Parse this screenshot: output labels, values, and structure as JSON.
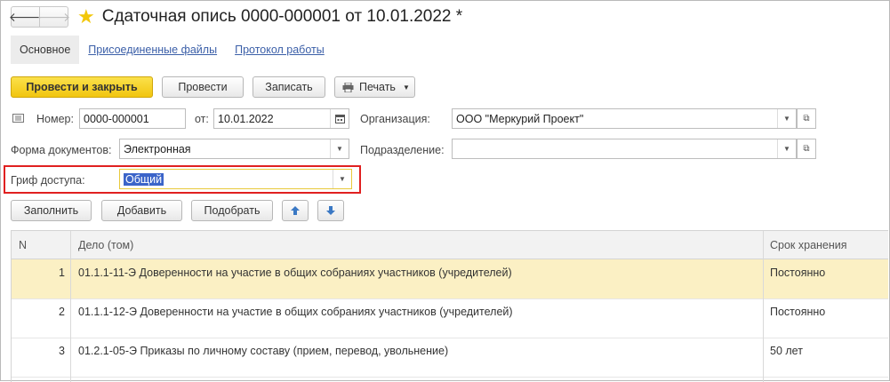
{
  "title_bar": {
    "back_icon": "arrow-left-icon",
    "forward_icon": "arrow-right-icon",
    "favorite_icon": "star-icon",
    "title": "Сдаточная опись 0000-000001 от 10.01.2022 *"
  },
  "tabs": [
    {
      "label": "Основное",
      "active": true
    },
    {
      "label": "Присоединенные файлы",
      "active": false
    },
    {
      "label": "Протокол работы",
      "active": false
    }
  ],
  "toolbar": {
    "post_close_label": "Провести и закрыть",
    "post_label": "Провести",
    "save_label": "Записать",
    "print_label": "Печать"
  },
  "form": {
    "number_label": "Номер:",
    "number_value": "0000-000001",
    "date_label": "от:",
    "date_value": "10.01.2022",
    "org_label": "Организация:",
    "org_value": "ООО \"Меркурий Проект\"",
    "doc_form_label": "Форма документов:",
    "doc_form_value": "Электронная",
    "subdivision_label": "Подразделение:",
    "subdivision_value": "",
    "access_label": "Гриф доступа:",
    "access_value": "Общий"
  },
  "table_toolbar": {
    "fill_label": "Заполнить",
    "add_label": "Добавить",
    "pick_label": "Подобрать",
    "up_icon": "arrow-up-icon",
    "down_icon": "arrow-down-icon"
  },
  "table": {
    "columns": [
      "N",
      "Дело (том)",
      "Срок хранения"
    ],
    "rows": [
      {
        "n": "1",
        "case": "01.1.1-11-Э Доверенности на участие в общих собраниях участников (учредителей)",
        "term": "Постоянно",
        "selected": true
      },
      {
        "n": "2",
        "case": "01.1.1-12-Э Доверенности на участие в общих собраниях участников (учредителей)",
        "term": "Постоянно",
        "selected": false
      },
      {
        "n": "3",
        "case": "01.2.1-05-Э Приказы по личному составу (прием, перевод, увольнение)",
        "term": "50 лет",
        "selected": false
      }
    ]
  },
  "colors": {
    "accent_yellow": "#f1c50f",
    "selected_row": "#fbf0c4",
    "highlight_border": "#e02020",
    "link": "#3b5fa8"
  }
}
